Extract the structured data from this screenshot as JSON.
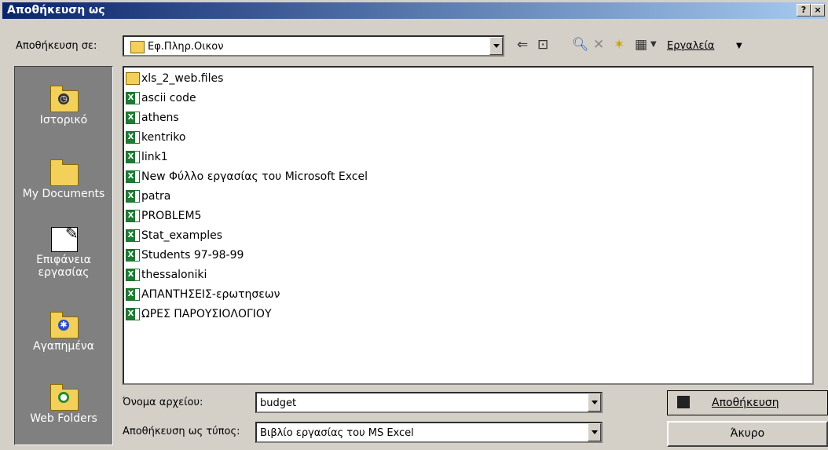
{
  "window": {
    "title": "Αποθήκευση ως",
    "help_label": "?",
    "close_label": "×"
  },
  "toolbar": {
    "save_in_label": "Αποθήκευση σε:",
    "current_folder": "Εφ.Πληρ.Οικον",
    "tools_label": "Εργαλεία"
  },
  "places": [
    {
      "label": "Ιστορικό",
      "icon": "history-icon"
    },
    {
      "label": "My Documents",
      "icon": "my-documents-icon"
    },
    {
      "label": "Επιφάνεια εργασίας",
      "icon": "desktop-icon"
    },
    {
      "label": "Αγαπημένα",
      "icon": "favorites-icon"
    },
    {
      "label": "Web Folders",
      "icon": "web-folders-icon"
    }
  ],
  "files": [
    {
      "name": "xls_2_web.files",
      "type": "folder"
    },
    {
      "name": "ascii code",
      "type": "excel"
    },
    {
      "name": "athens",
      "type": "excel"
    },
    {
      "name": "kentriko",
      "type": "excel"
    },
    {
      "name": "link1",
      "type": "excel"
    },
    {
      "name": "New Φύλλο εργασίας του Microsoft Excel",
      "type": "excel"
    },
    {
      "name": "patra",
      "type": "excel"
    },
    {
      "name": "PROBLEM5",
      "type": "excel"
    },
    {
      "name": "Stat_examples",
      "type": "excel"
    },
    {
      "name": "Students 97-98-99",
      "type": "excel"
    },
    {
      "name": "thessaloniki",
      "type": "excel"
    },
    {
      "name": "ΑΠΑΝΤΗΣΕΙΣ-ερωτησεων",
      "type": "excel"
    },
    {
      "name": "ΩΡΕΣ ΠΑΡΟΥΣΙΟΛΟΓΙΟΥ",
      "type": "excel"
    }
  ],
  "filename": {
    "label": "Όνομα αρχείου:",
    "value": "budget"
  },
  "filetype": {
    "label": "Αποθήκευση ως τύπος:",
    "value": "Βιβλίο εργασίας του MS Excel"
  },
  "buttons": {
    "save": "Αποθήκευση",
    "cancel": "Άκυρο"
  },
  "colors": {
    "titlebar_start": "#0a246a",
    "titlebar_end": "#a6caf0",
    "dialog_bg": "#d4d0c8",
    "places_bg": "#808080"
  }
}
